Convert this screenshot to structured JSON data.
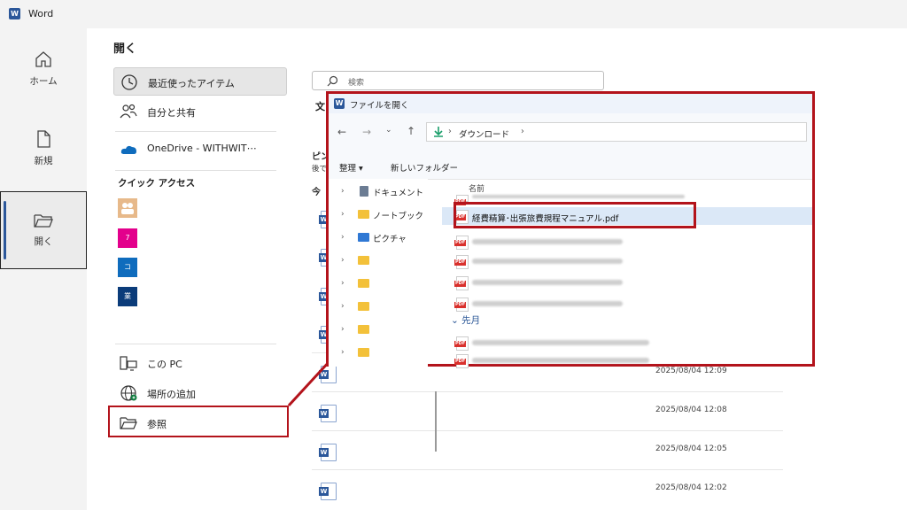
{
  "app": {
    "title": "Word"
  },
  "nav": {
    "home": "ホーム",
    "new": "新規",
    "open": "開く"
  },
  "open_panel": {
    "title": "開く",
    "recent": "最近使ったアイテム",
    "shared": "自分と共有",
    "onedrive": "OneDrive - WITHWIT⋯",
    "quick_access": "クイック アクセス",
    "quick_items": [
      {
        "letter": "",
        "color": "#e7b98a"
      },
      {
        "letter": "7",
        "color": "#e3008c"
      },
      {
        "letter": "コ",
        "color": "#0f6cbd"
      },
      {
        "letter": "業",
        "color": "#0b3c7a"
      }
    ],
    "this_pc": "この PC",
    "add_place": "場所の追加",
    "browse": "参照"
  },
  "main": {
    "search_placeholder": "検索",
    "tab_docs": "文",
    "pinned_label": "ピン",
    "pinned_sub": "後で",
    "today_label": "今",
    "files": [
      {
        "date": "2025/08/04 12:09"
      },
      {
        "date": "2025/08/04 12:08"
      },
      {
        "date": "2025/08/04 12:05"
      },
      {
        "date": "2025/08/04 12:02"
      }
    ]
  },
  "dialog": {
    "title": "ファイルを開く",
    "path": [
      "ダウンロード"
    ],
    "organize": "整理 ▾",
    "new_folder": "新しいフォルダー",
    "tree": [
      "ドキュメント",
      "ノートブック",
      "ピクチャ",
      "",
      "",
      "",
      "",
      ""
    ],
    "column_name": "名前",
    "target_file": "経費精算･出張旅費規程マニュアル.pdf",
    "group_last_month": "先月"
  },
  "colors": {
    "highlight": "#b3131b",
    "accent": "#2b579a"
  }
}
